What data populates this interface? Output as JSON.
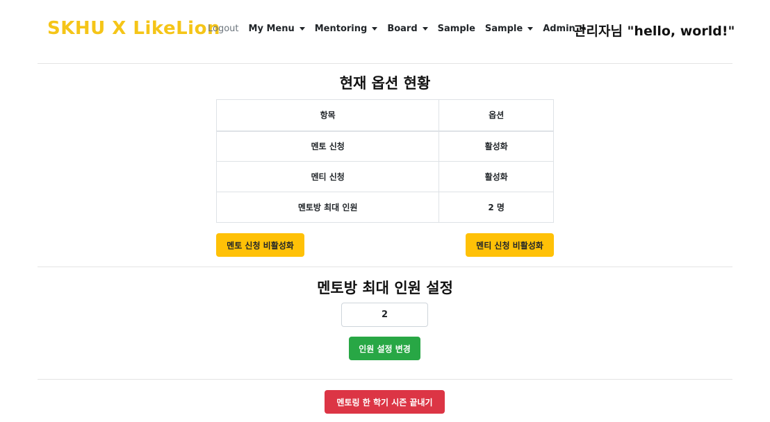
{
  "navbar": {
    "brand": "SKHU X LikeLion",
    "items": [
      {
        "label": "Logout",
        "dropdown": false
      },
      {
        "label": "My Menu",
        "dropdown": true
      },
      {
        "label": "Mentoring",
        "dropdown": true
      },
      {
        "label": "Board",
        "dropdown": true
      },
      {
        "label": "Sample",
        "dropdown": false
      },
      {
        "label": "Sample",
        "dropdown": true
      },
      {
        "label": "Admin",
        "dropdown": true
      }
    ],
    "greeting": "관리자님 \"hello, world!\""
  },
  "options_section": {
    "title": "현재 옵션 현황",
    "headers": [
      "항목",
      "옵션"
    ],
    "rows": [
      [
        "멘토 신청",
        "활성화"
      ],
      [
        "멘티 신청",
        "활성화"
      ],
      [
        "멘토방 최대 인원",
        "2 명"
      ]
    ],
    "mentor_toggle_label": "멘토 신청 비활성화",
    "mentee_toggle_label": "멘티 신청 비활성화"
  },
  "capacity_section": {
    "title": "멘토방 최대 인원 설정",
    "input_value": "2",
    "submit_label": "인원 설정 변경"
  },
  "season": {
    "end_label": "멘토링 한 학기 시즌 끝내기"
  },
  "colors": {
    "brand": "#f5c518",
    "warning": "#ffc107",
    "success": "#28a745",
    "danger": "#dc3545"
  }
}
